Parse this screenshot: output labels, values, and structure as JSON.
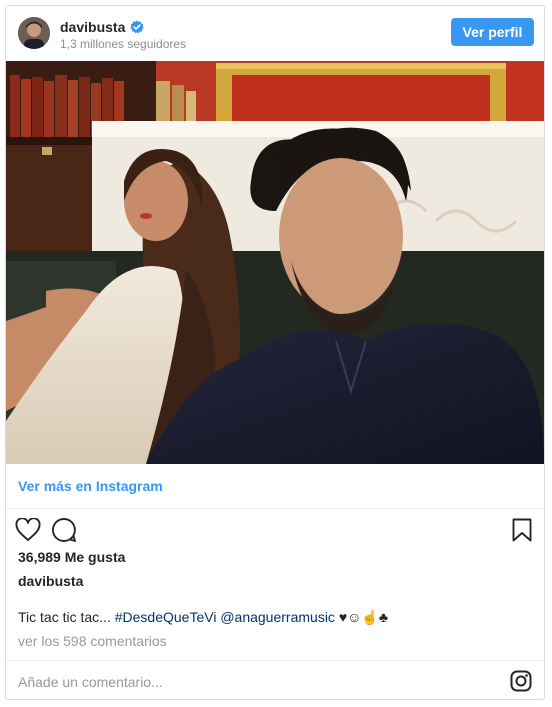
{
  "header": {
    "username": "davibusta",
    "followers": "1,3 millones seguidores",
    "profile_button": "Ver perfil"
  },
  "post": {
    "more_link": "Ver más en Instagram",
    "likes": "36,989 Me gusta",
    "author": "davibusta",
    "caption_text": "Tic tac tic tac...",
    "caption_hashtag": "#DesdeQueTeVi",
    "caption_mention": "@anaguerramusic",
    "caption_emoji": "♥☺☝♣",
    "comments_link": "ver los 598 comentarios"
  },
  "comment_box": {
    "placeholder": "Añade un comentario..."
  },
  "icons": {
    "verified": "verified-badge-icon",
    "like": "heart-icon",
    "comment": "comment-bubble-icon",
    "save": "bookmark-icon",
    "instagram": "instagram-logo-icon"
  },
  "colors": {
    "accent": "#3897f0",
    "link_dark": "#003569",
    "muted": "#999999"
  }
}
